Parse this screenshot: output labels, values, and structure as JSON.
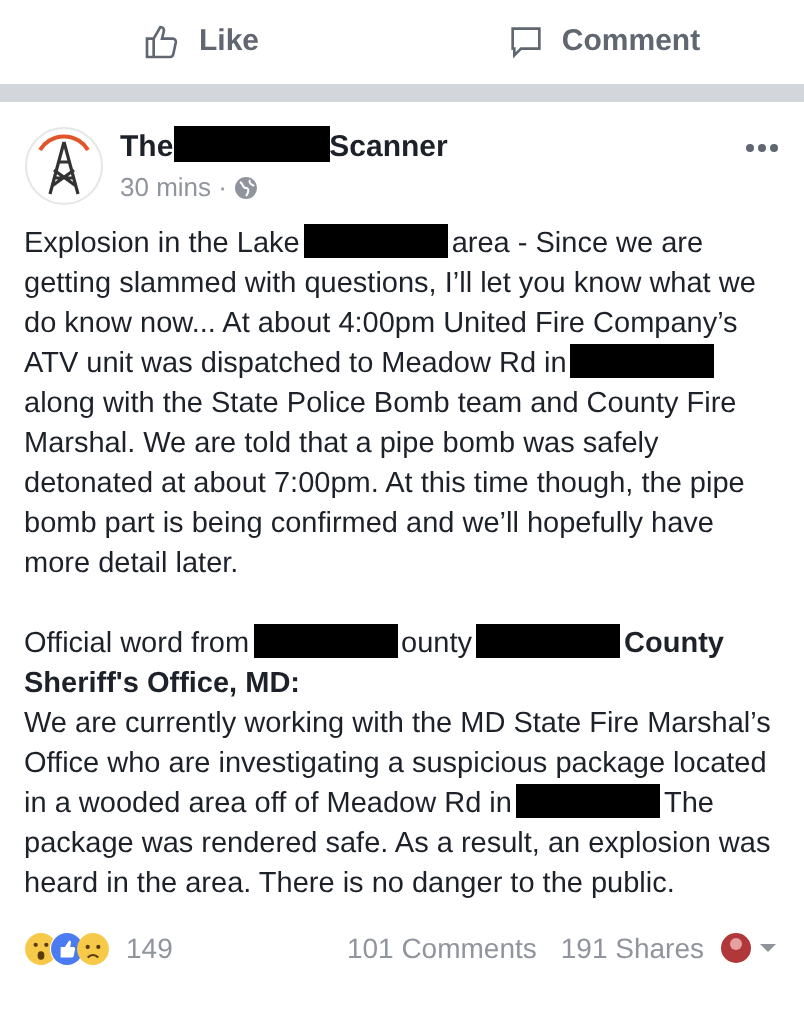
{
  "action_bar": [
    {
      "kind": "like",
      "label": "Like"
    },
    {
      "kind": "comment",
      "label": "Comment"
    }
  ],
  "post": {
    "author": [
      {
        "kind": "text",
        "text": "The"
      },
      {
        "kind": "redacted"
      },
      {
        "kind": "text",
        "text": "Scanner"
      }
    ],
    "time": "30 mins ·",
    "paragraphs": [
      [
        {
          "kind": "text",
          "text": "Explosion in the Lake"
        },
        {
          "kind": "redacted"
        },
        {
          "kind": "text",
          "text": "area - Since we are getting slammed with questions, I’ll let you know what we do know now... At about 4:00pm United Fire Company’s ATV unit was dispatched to Meadow Rd in"
        },
        {
          "kind": "redacted"
        },
        {
          "kind": "text",
          "text": "along with the State Police Bomb team and County Fire Marshal. We are told that a pipe bomb was safely detonated at about 7:00pm. At this time though, the pipe bomb part is being confirmed and we’ll hopefully have more detail later."
        }
      ],
      [
        {
          "kind": "text",
          "text": "Official word from"
        },
        {
          "kind": "redacted"
        },
        {
          "kind": "text",
          "text": "ounty"
        },
        {
          "kind": "redacted"
        },
        {
          "kind": "text",
          "text": "**County Sheriff's Office, MD:**"
        }
      ],
      [
        {
          "kind": "text",
          "text": "We are currently working with the MD State Fire Marshal’s Office who are investigating a suspicious package located in a wooded area off of Meadow Rd in"
        },
        {
          "kind": "redacted"
        },
        {
          "kind": "text",
          "text": "The package was rendered safe. As a result, an explosion was heard in the area. There is no danger to the public."
        }
      ]
    ],
    "reactions": [
      {
        "kind": "wow"
      },
      {
        "kind": "like"
      },
      {
        "kind": "sad"
      }
    ],
    "reaction_count": "149",
    "comments": "101 Comments",
    "shares": "191 Shares"
  }
}
